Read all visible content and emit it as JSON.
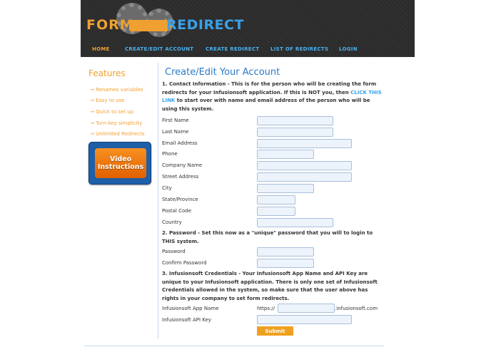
{
  "brand": {
    "form": "FORM",
    "redirect": "REDIRECT"
  },
  "nav": {
    "home": "HOME",
    "create_edit_account": "CREATE/EDIT ACCOUNT",
    "create_redirect": "CREATE REDIRECT",
    "list_of_redirects": "LIST OF REDIRECTS",
    "login": "LOGIN"
  },
  "sidebar": {
    "title": "Features",
    "items": [
      "Renames variables",
      "Easy to use",
      "Quick to set up",
      "Turn-key simplicity",
      "Unlimited Redirects"
    ],
    "video_line1": "Video",
    "video_line2": "Instructions"
  },
  "main": {
    "title": "Create/Edit Your Account",
    "section1_before": "1. Contact Information - This is for the person who will be creating the form redirects for your Infusionsoft application. If this is NOT you, then ",
    "section1_link": "CLICK THIS LINK",
    "section1_after": " to start over with name and email address of the person who will be using this system.",
    "contact_fields": [
      "First Name",
      "Last Name",
      "Email Address",
      "Phone",
      "Company Name",
      "Street Address",
      "City",
      "State/Province",
      "Postal Code",
      "Country"
    ],
    "section2": "2. Password - Set this now as a \"unique\" password that you will to login to THIS system.",
    "password_label": "Password",
    "confirm_password_label": "Confirm Password",
    "section3": "3. Infusionsoft Credentials - Your Infusionsoft App Name and API Key are unique to your Infusionsoft application. There is only one set of Infusionsoft Credentials allowed in the system, so make sure that the user above has rights in your company to set form redirects.",
    "app_name_label": "Infusionsoft App Name",
    "app_prefix": "https://",
    "app_suffix": ".infusionsoft.com",
    "api_key_label": "Infusionsoft API Key",
    "submit": "Submit"
  },
  "colors": {
    "accent_orange": "#f0a030",
    "accent_blue": "#2a7ac8",
    "nav_blue": "#4ab0f0",
    "input_bg": "#edf3fb"
  }
}
